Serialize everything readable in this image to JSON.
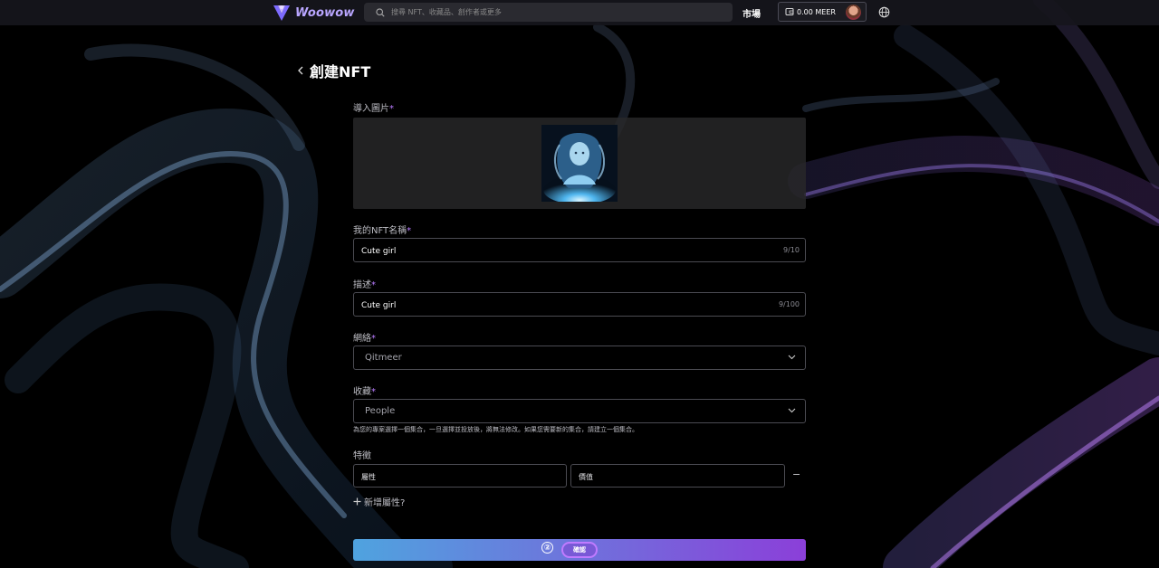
{
  "header": {
    "brand": "Woowow",
    "search_placeholder": "搜尋 NFT、收藏品、創作者或更多",
    "market_label": "市場",
    "wallet_balance": "0.00 MEER"
  },
  "page": {
    "title": "創建NFT"
  },
  "form": {
    "image": {
      "label": "導入圖片",
      "required_mark": "*"
    },
    "name": {
      "label": "我的NFT名稱",
      "required_mark": "*",
      "value": "Cute girl",
      "counter": "9/10"
    },
    "description": {
      "label": "描述",
      "required_mark": "*",
      "value": "Cute girl",
      "counter": "9/100"
    },
    "network": {
      "label": "網絡",
      "required_mark": "*",
      "selected": "Qitmeer"
    },
    "collection": {
      "label": "收藏",
      "required_mark": "*",
      "selected": "People",
      "hint": "為您的專案選擇一個集合，一旦選擇並投放後，將無法修改。如果您需要新的集合，請建立一個集合。"
    },
    "traits": {
      "label": "特徵",
      "attribute_placeholder": "屬性",
      "value_placeholder": "價值",
      "remove_label": "−",
      "add_label": "新增屬性?"
    },
    "submit": {
      "step_marker": "②",
      "label": "確認"
    }
  },
  "colors": {
    "accent": "#b97bff",
    "button_gradient_start": "#4fa3df",
    "button_gradient_end": "#8b3fd9"
  }
}
